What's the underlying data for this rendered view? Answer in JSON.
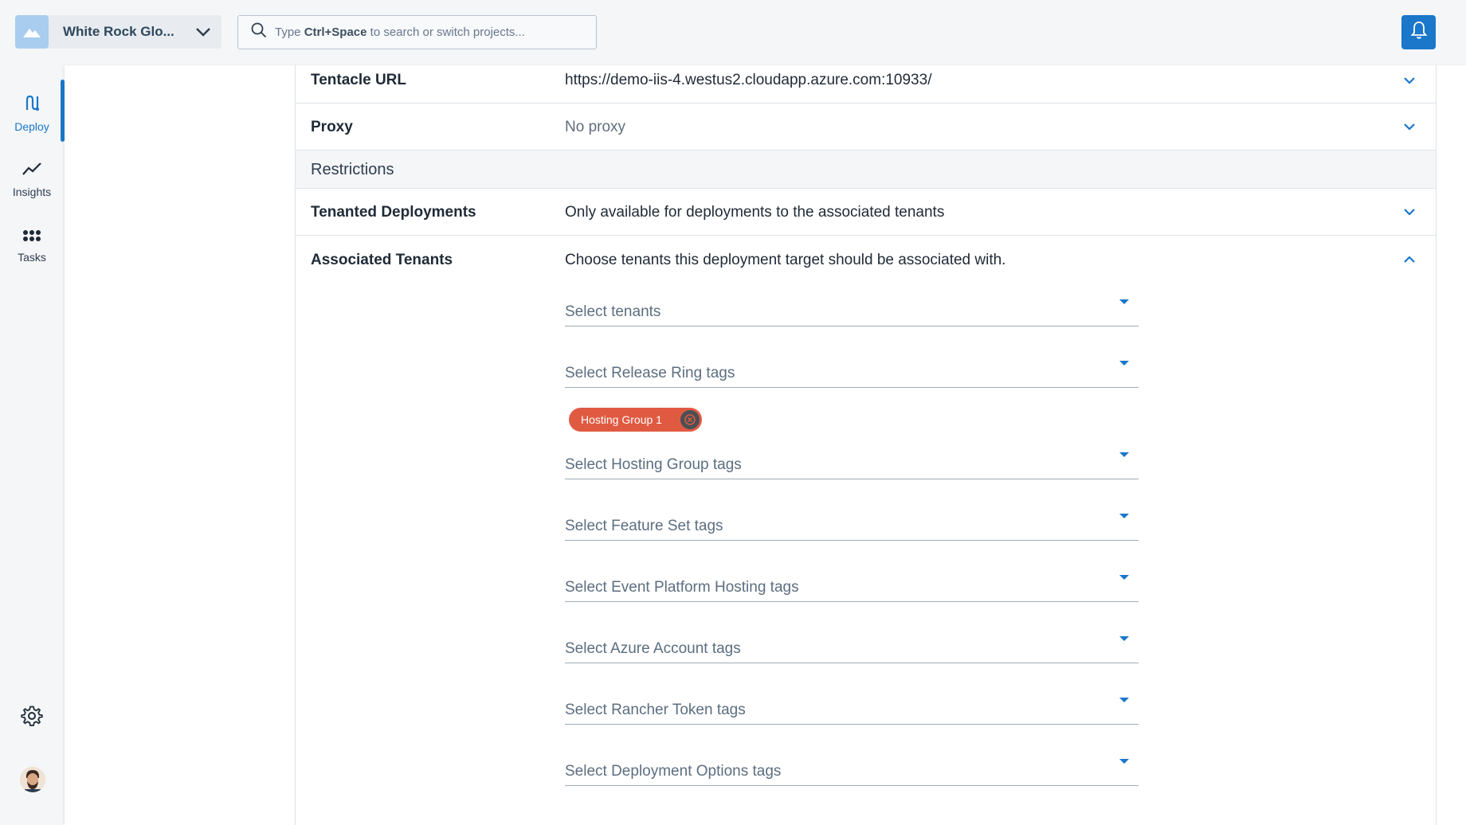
{
  "header": {
    "space_name": "White Rock Glo...",
    "search_placeholder_prefix": "Type ",
    "search_placeholder_shortcut": "Ctrl+Space",
    "search_placeholder_suffix": " to search or switch projects...",
    "accent_color": "#1a77ca"
  },
  "nav": {
    "items": [
      {
        "label": "Deploy",
        "icon": "deploy-icon",
        "active": true
      },
      {
        "label": "Insights",
        "icon": "insights-icon",
        "active": false
      },
      {
        "label": "Tasks",
        "icon": "tasks-icon",
        "active": false
      }
    ],
    "settings_icon": "gear-icon",
    "avatar_icon": "avatar"
  },
  "rows": {
    "tentacle_url": {
      "label": "Tentacle URL",
      "value": "https://demo-iis-4.westus2.cloudapp.azure.com:10933/"
    },
    "proxy": {
      "label": "Proxy",
      "value": "No proxy"
    },
    "restrictions_title": "Restrictions",
    "tenanted": {
      "label": "Tenanted Deployments",
      "value": "Only available for deployments to the associated tenants"
    },
    "associated": {
      "label": "Associated Tenants",
      "value": "Choose tenants this deployment target should be associated with."
    }
  },
  "selects": {
    "tenants": "Select tenants",
    "release_ring": "Select Release Ring tags",
    "hosting_group": "Select Hosting Group tags",
    "feature_set": "Select Feature Set tags",
    "event_platform": "Select Event Platform Hosting tags",
    "azure_account": "Select Azure Account tags",
    "rancher_token": "Select Rancher Token tags",
    "deployment_options": "Select Deployment Options tags"
  },
  "chips": {
    "hosting_group_1": {
      "label": "Hosting Group 1",
      "color": "#e05a42"
    }
  }
}
